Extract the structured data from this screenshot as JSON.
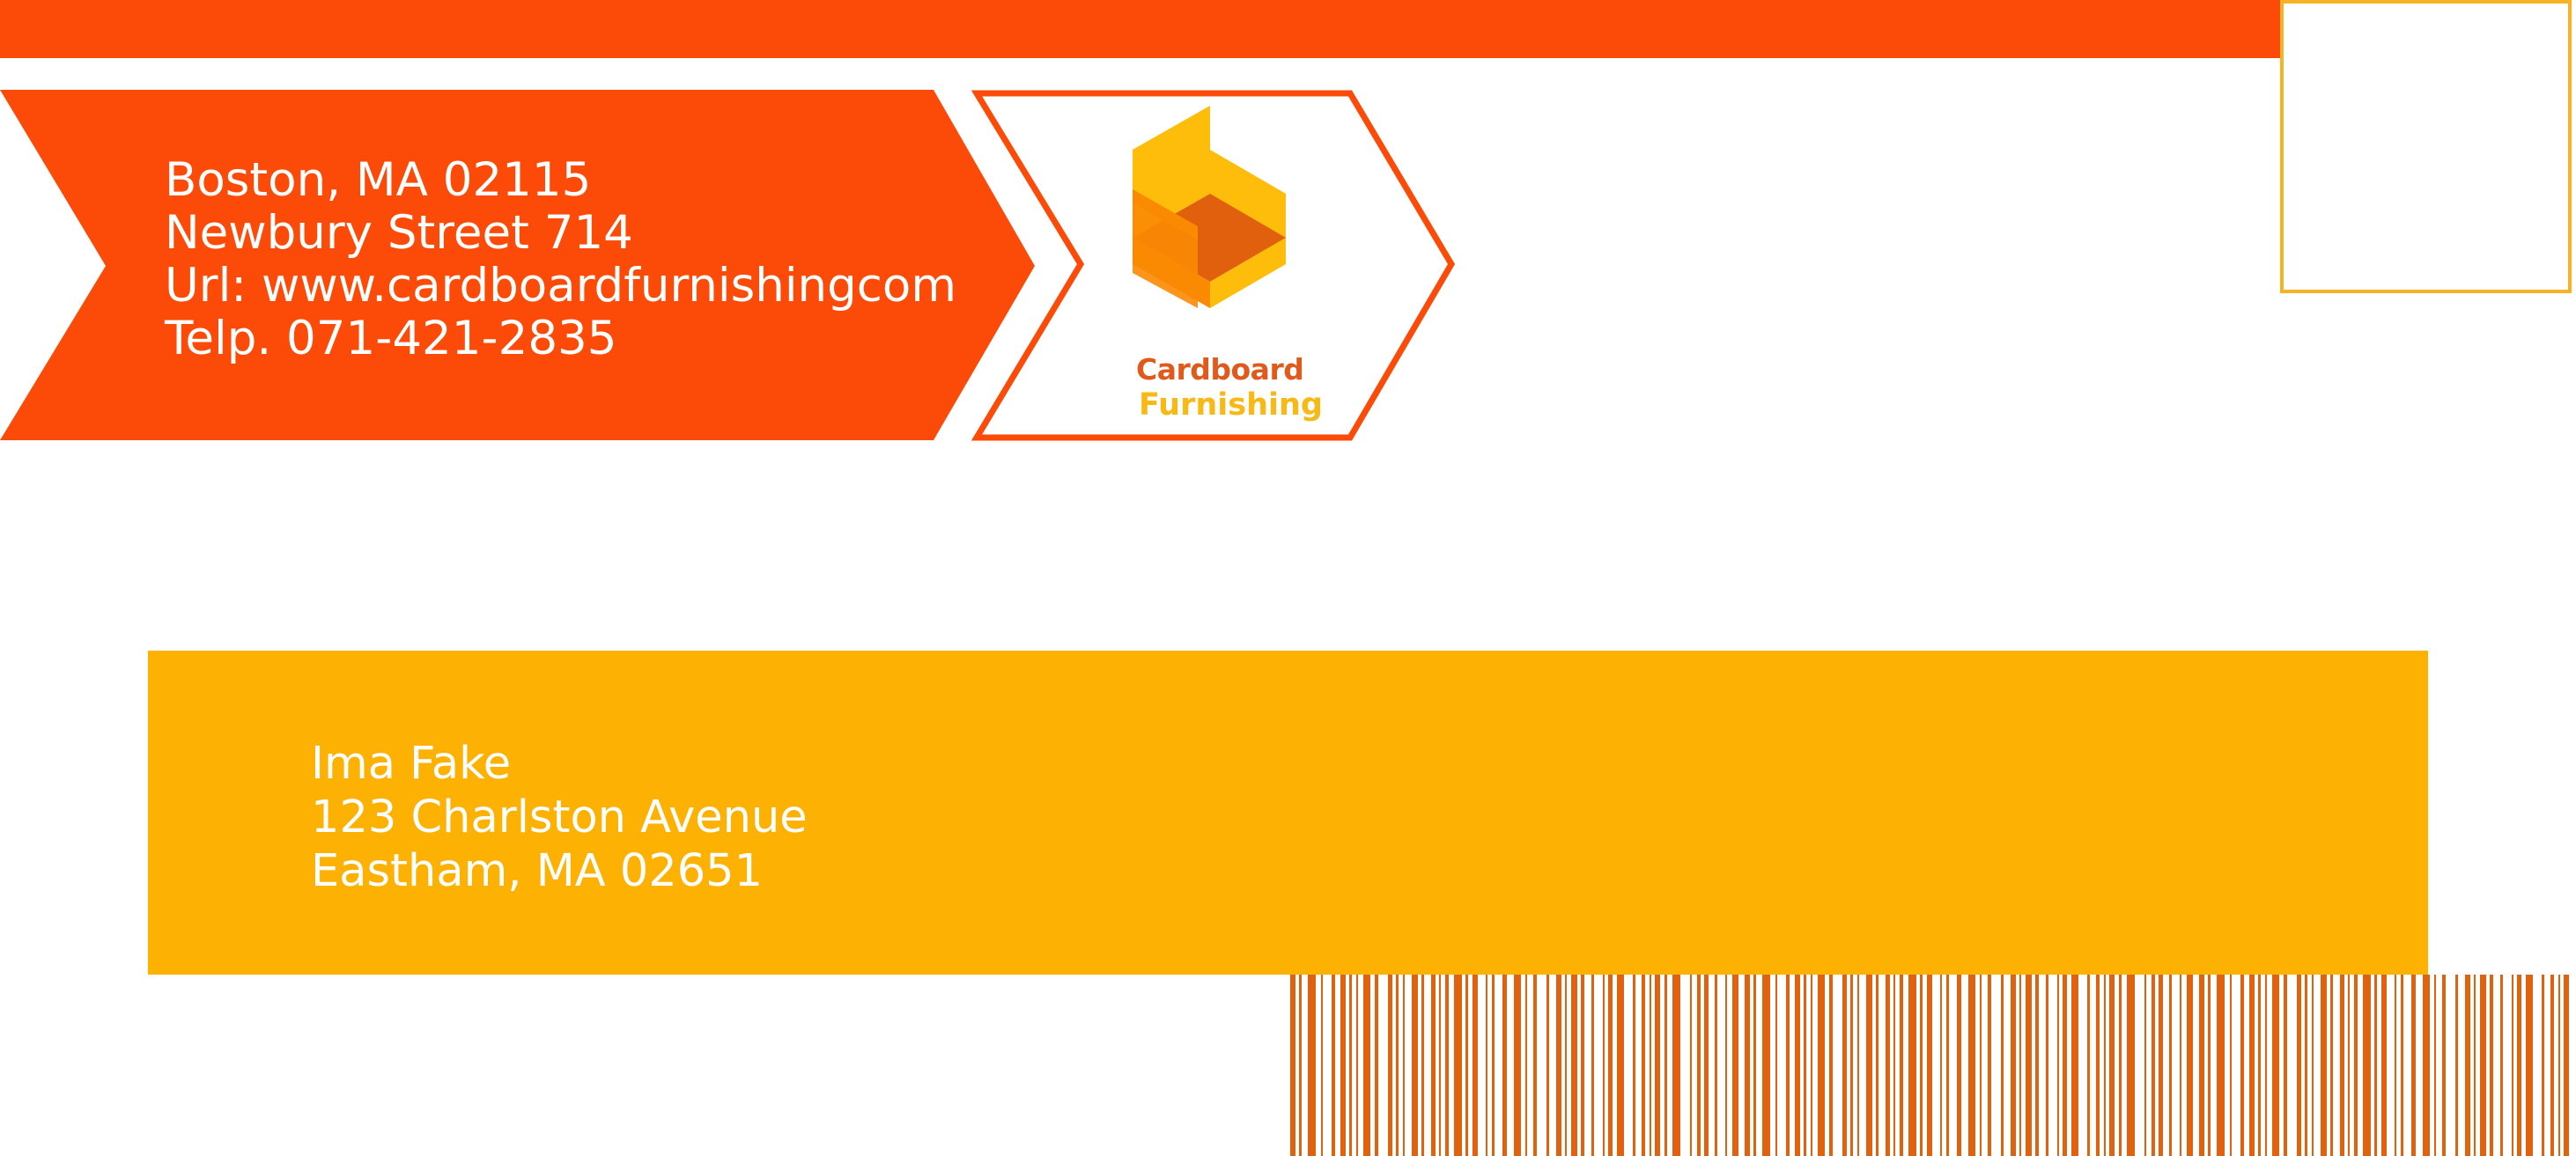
{
  "return_address": {
    "line1": "Boston, MA 02115",
    "line2": "Newbury Street 714",
    "line3": "Url: www.cardboardfurnishingcom",
    "line4": "Telp. 071-421-2835"
  },
  "brand": {
    "name_top": "Cardboard",
    "name_bottom": "Furnishing",
    "icon": "cardboard-chair-logo"
  },
  "recipient": {
    "name": "Ima Fake",
    "street": "123 Charlston Avenue",
    "city": "Eastham, MA 02651"
  },
  "colors": {
    "primary_orange": "#fc4b08",
    "address_yellow": "#fdb102",
    "stamp_border": "#f5b325",
    "barcode": "#e0620e"
  }
}
